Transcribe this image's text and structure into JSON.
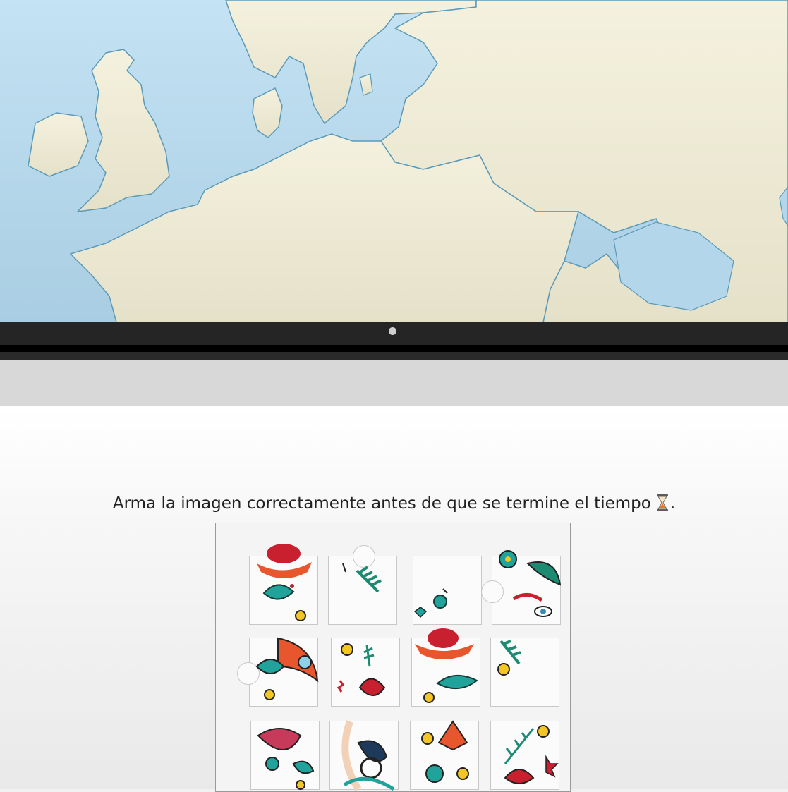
{
  "banner": {
    "image": "map-of-northern-europe",
    "colors": {
      "sea": "#b9dcef",
      "land": "#f2efdc",
      "coast": "#5a9ab8"
    }
  },
  "carousel": {
    "indicator_count": 1,
    "active_index": 0
  },
  "game": {
    "instruction": "Arma la imagen correctamente antes de que se termine el tiempo",
    "instruction_suffix": ".",
    "timer_icon": "hourglass-icon",
    "board": {
      "rows_visible": 3,
      "cols": 4
    },
    "pieces": [
      {
        "motif": "red-hat-teal-leaf"
      },
      {
        "motif": "palm-sprig"
      },
      {
        "motif": "teal-swirl-star"
      },
      {
        "motif": "flower-face-eye"
      },
      {
        "motif": "flower-wave"
      },
      {
        "motif": "sun-star-rose"
      },
      {
        "motif": "red-hat-leaf-sun"
      },
      {
        "motif": "palm-sun"
      },
      {
        "motif": "rose-wave"
      },
      {
        "motif": "woman-hair-swirl"
      },
      {
        "motif": "stars-teal-flower"
      },
      {
        "motif": "branch-rose-star"
      }
    ]
  }
}
